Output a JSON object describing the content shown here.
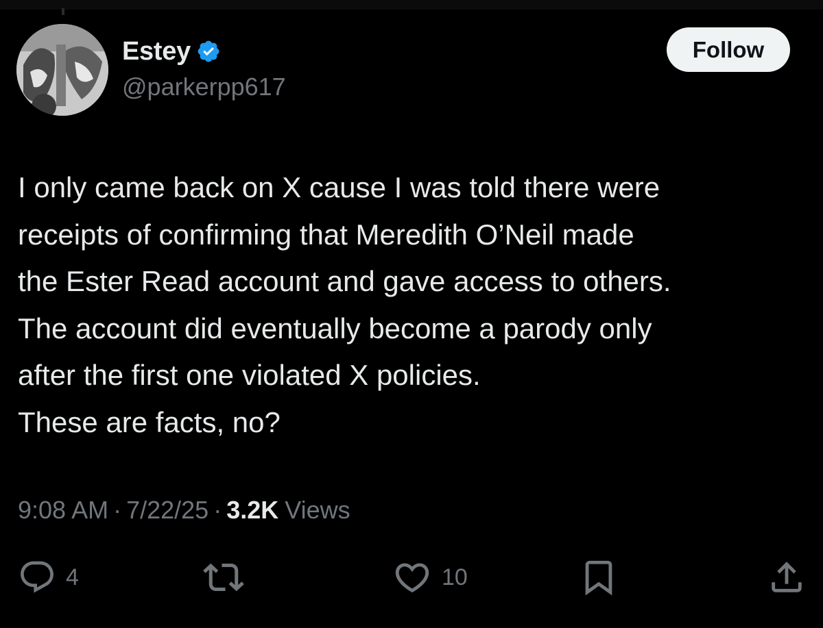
{
  "author": {
    "display_name": "Estey",
    "handle": "@parkerpp617",
    "verified": true
  },
  "follow_label": "Follow",
  "tweet": {
    "lines": [
      "I only came back on X cause I was told there were",
      "receipts of confirming that Meredith O’Neil made",
      "the Ester Read account and gave access to others.",
      "The account did eventually become a parody only",
      "after the first one violated X policies.",
      "These are facts, no?"
    ]
  },
  "meta": {
    "time": "9:08 AM",
    "date": "7/22/25",
    "separator": "·",
    "views_count": "3.2K",
    "views_label": "Views"
  },
  "actions": {
    "reply_count": "4",
    "like_count": "10"
  },
  "colors": {
    "background": "#000000",
    "text": "#e7e9ea",
    "secondary": "#71767b",
    "verified": "#1d9bf0",
    "follow_bg": "#eff3f4"
  },
  "icons": [
    "verified-badge-icon",
    "reply-icon",
    "retweet-icon",
    "like-icon",
    "bookmark-icon",
    "share-icon"
  ]
}
